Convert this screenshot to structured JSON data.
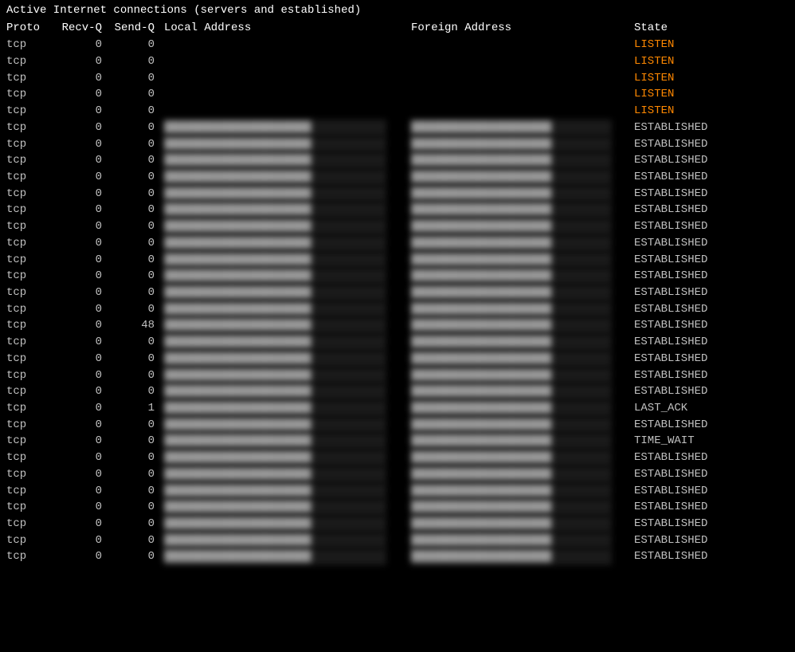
{
  "title": "Active Internet connections (servers and established)",
  "header": {
    "proto": "Proto",
    "recvq": "Recv-Q",
    "sendq": "Send-Q",
    "local": "Local Address",
    "foreign": "Foreign Address",
    "state": "State"
  },
  "rows": [
    {
      "proto": "tcp",
      "recvq": "0",
      "sendq": "0",
      "state": "LISTEN",
      "stateClass": "state-listen"
    },
    {
      "proto": "tcp",
      "recvq": "0",
      "sendq": "0",
      "state": "LISTEN",
      "stateClass": "state-listen"
    },
    {
      "proto": "tcp",
      "recvq": "0",
      "sendq": "0",
      "state": "LISTEN",
      "stateClass": "state-listen"
    },
    {
      "proto": "tcp",
      "recvq": "0",
      "sendq": "0",
      "state": "LISTEN",
      "stateClass": "state-listen"
    },
    {
      "proto": "tcp",
      "recvq": "0",
      "sendq": "0",
      "state": "LISTEN",
      "stateClass": "state-listen"
    },
    {
      "proto": "tcp",
      "recvq": "0",
      "sendq": "0",
      "state": "ESTABLISHED",
      "stateClass": "state-established"
    },
    {
      "proto": "tcp",
      "recvq": "0",
      "sendq": "0",
      "state": "ESTABLISHED",
      "stateClass": "state-established"
    },
    {
      "proto": "tcp",
      "recvq": "0",
      "sendq": "0",
      "state": "ESTABLISHED",
      "stateClass": "state-established"
    },
    {
      "proto": "tcp",
      "recvq": "0",
      "sendq": "0",
      "state": "ESTABLISHED",
      "stateClass": "state-established"
    },
    {
      "proto": "tcp",
      "recvq": "0",
      "sendq": "0",
      "state": "ESTABLISHED",
      "stateClass": "state-established"
    },
    {
      "proto": "tcp",
      "recvq": "0",
      "sendq": "0",
      "state": "ESTABLISHED",
      "stateClass": "state-established"
    },
    {
      "proto": "tcp",
      "recvq": "0",
      "sendq": "0",
      "state": "ESTABLISHED",
      "stateClass": "state-established"
    },
    {
      "proto": "tcp",
      "recvq": "0",
      "sendq": "0",
      "state": "ESTABLISHED",
      "stateClass": "state-established"
    },
    {
      "proto": "tcp",
      "recvq": "0",
      "sendq": "0",
      "state": "ESTABLISHED",
      "stateClass": "state-established"
    },
    {
      "proto": "tcp",
      "recvq": "0",
      "sendq": "0",
      "state": "ESTABLISHED",
      "stateClass": "state-established"
    },
    {
      "proto": "tcp",
      "recvq": "0",
      "sendq": "0",
      "state": "ESTABLISHED",
      "stateClass": "state-established"
    },
    {
      "proto": "tcp",
      "recvq": "0",
      "sendq": "0",
      "state": "ESTABLISHED",
      "stateClass": "state-established"
    },
    {
      "proto": "tcp",
      "recvq": "0",
      "sendq": "48",
      "state": "ESTABLISHED",
      "stateClass": "state-established"
    },
    {
      "proto": "tcp",
      "recvq": "0",
      "sendq": "0",
      "state": "ESTABLISHED",
      "stateClass": "state-established"
    },
    {
      "proto": "tcp",
      "recvq": "0",
      "sendq": "0",
      "state": "ESTABLISHED",
      "stateClass": "state-established"
    },
    {
      "proto": "tcp",
      "recvq": "0",
      "sendq": "0",
      "state": "ESTABLISHED",
      "stateClass": "state-established"
    },
    {
      "proto": "tcp",
      "recvq": "0",
      "sendq": "0",
      "state": "ESTABLISHED",
      "stateClass": "state-established"
    },
    {
      "proto": "tcp",
      "recvq": "0",
      "sendq": "1",
      "state": "LAST_ACK",
      "stateClass": "state-last-ack"
    },
    {
      "proto": "tcp",
      "recvq": "0",
      "sendq": "0",
      "state": "ESTABLISHED",
      "stateClass": "state-established"
    },
    {
      "proto": "tcp",
      "recvq": "0",
      "sendq": "0",
      "state": "TIME_WAIT",
      "stateClass": "state-time-wait"
    },
    {
      "proto": "tcp",
      "recvq": "0",
      "sendq": "0",
      "state": "ESTABLISHED",
      "stateClass": "state-established"
    },
    {
      "proto": "tcp",
      "recvq": "0",
      "sendq": "0",
      "state": "ESTABLISHED",
      "stateClass": "state-established"
    },
    {
      "proto": "tcp",
      "recvq": "0",
      "sendq": "0",
      "state": "ESTABLISHED",
      "stateClass": "state-established"
    },
    {
      "proto": "tcp",
      "recvq": "0",
      "sendq": "0",
      "state": "ESTABLISHED",
      "stateClass": "state-established"
    },
    {
      "proto": "tcp",
      "recvq": "0",
      "sendq": "0",
      "state": "ESTABLISHED",
      "stateClass": "state-established"
    },
    {
      "proto": "tcp",
      "recvq": "0",
      "sendq": "0",
      "state": "ESTABLISHED",
      "stateClass": "state-established"
    },
    {
      "proto": "tcp",
      "recvq": "0",
      "sendq": "0",
      "state": "ESTABLISHED",
      "stateClass": "state-established"
    }
  ],
  "colors": {
    "background": "#000000",
    "text": "#c0c0c0",
    "header": "#ffffff",
    "listen": "#ff8800",
    "established": "#c0c0c0"
  }
}
